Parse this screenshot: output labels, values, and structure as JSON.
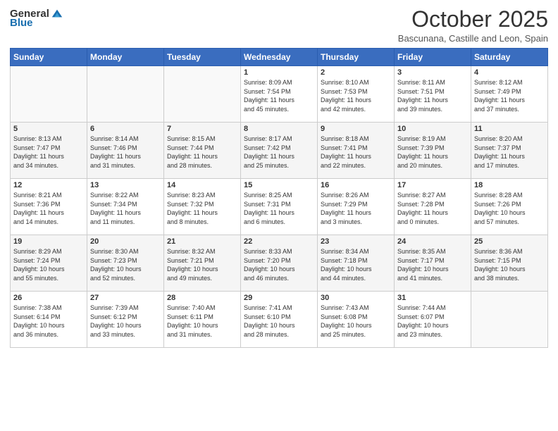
{
  "header": {
    "logo_general": "General",
    "logo_blue": "Blue",
    "month": "October 2025",
    "location": "Bascunana, Castille and Leon, Spain"
  },
  "weekdays": [
    "Sunday",
    "Monday",
    "Tuesday",
    "Wednesday",
    "Thursday",
    "Friday",
    "Saturday"
  ],
  "weeks": [
    [
      {
        "day": "",
        "info": ""
      },
      {
        "day": "",
        "info": ""
      },
      {
        "day": "",
        "info": ""
      },
      {
        "day": "1",
        "info": "Sunrise: 8:09 AM\nSunset: 7:54 PM\nDaylight: 11 hours\nand 45 minutes."
      },
      {
        "day": "2",
        "info": "Sunrise: 8:10 AM\nSunset: 7:53 PM\nDaylight: 11 hours\nand 42 minutes."
      },
      {
        "day": "3",
        "info": "Sunrise: 8:11 AM\nSunset: 7:51 PM\nDaylight: 11 hours\nand 39 minutes."
      },
      {
        "day": "4",
        "info": "Sunrise: 8:12 AM\nSunset: 7:49 PM\nDaylight: 11 hours\nand 37 minutes."
      }
    ],
    [
      {
        "day": "5",
        "info": "Sunrise: 8:13 AM\nSunset: 7:47 PM\nDaylight: 11 hours\nand 34 minutes."
      },
      {
        "day": "6",
        "info": "Sunrise: 8:14 AM\nSunset: 7:46 PM\nDaylight: 11 hours\nand 31 minutes."
      },
      {
        "day": "7",
        "info": "Sunrise: 8:15 AM\nSunset: 7:44 PM\nDaylight: 11 hours\nand 28 minutes."
      },
      {
        "day": "8",
        "info": "Sunrise: 8:17 AM\nSunset: 7:42 PM\nDaylight: 11 hours\nand 25 minutes."
      },
      {
        "day": "9",
        "info": "Sunrise: 8:18 AM\nSunset: 7:41 PM\nDaylight: 11 hours\nand 22 minutes."
      },
      {
        "day": "10",
        "info": "Sunrise: 8:19 AM\nSunset: 7:39 PM\nDaylight: 11 hours\nand 20 minutes."
      },
      {
        "day": "11",
        "info": "Sunrise: 8:20 AM\nSunset: 7:37 PM\nDaylight: 11 hours\nand 17 minutes."
      }
    ],
    [
      {
        "day": "12",
        "info": "Sunrise: 8:21 AM\nSunset: 7:36 PM\nDaylight: 11 hours\nand 14 minutes."
      },
      {
        "day": "13",
        "info": "Sunrise: 8:22 AM\nSunset: 7:34 PM\nDaylight: 11 hours\nand 11 minutes."
      },
      {
        "day": "14",
        "info": "Sunrise: 8:23 AM\nSunset: 7:32 PM\nDaylight: 11 hours\nand 8 minutes."
      },
      {
        "day": "15",
        "info": "Sunrise: 8:25 AM\nSunset: 7:31 PM\nDaylight: 11 hours\nand 6 minutes."
      },
      {
        "day": "16",
        "info": "Sunrise: 8:26 AM\nSunset: 7:29 PM\nDaylight: 11 hours\nand 3 minutes."
      },
      {
        "day": "17",
        "info": "Sunrise: 8:27 AM\nSunset: 7:28 PM\nDaylight: 11 hours\nand 0 minutes."
      },
      {
        "day": "18",
        "info": "Sunrise: 8:28 AM\nSunset: 7:26 PM\nDaylight: 10 hours\nand 57 minutes."
      }
    ],
    [
      {
        "day": "19",
        "info": "Sunrise: 8:29 AM\nSunset: 7:24 PM\nDaylight: 10 hours\nand 55 minutes."
      },
      {
        "day": "20",
        "info": "Sunrise: 8:30 AM\nSunset: 7:23 PM\nDaylight: 10 hours\nand 52 minutes."
      },
      {
        "day": "21",
        "info": "Sunrise: 8:32 AM\nSunset: 7:21 PM\nDaylight: 10 hours\nand 49 minutes."
      },
      {
        "day": "22",
        "info": "Sunrise: 8:33 AM\nSunset: 7:20 PM\nDaylight: 10 hours\nand 46 minutes."
      },
      {
        "day": "23",
        "info": "Sunrise: 8:34 AM\nSunset: 7:18 PM\nDaylight: 10 hours\nand 44 minutes."
      },
      {
        "day": "24",
        "info": "Sunrise: 8:35 AM\nSunset: 7:17 PM\nDaylight: 10 hours\nand 41 minutes."
      },
      {
        "day": "25",
        "info": "Sunrise: 8:36 AM\nSunset: 7:15 PM\nDaylight: 10 hours\nand 38 minutes."
      }
    ],
    [
      {
        "day": "26",
        "info": "Sunrise: 7:38 AM\nSunset: 6:14 PM\nDaylight: 10 hours\nand 36 minutes."
      },
      {
        "day": "27",
        "info": "Sunrise: 7:39 AM\nSunset: 6:12 PM\nDaylight: 10 hours\nand 33 minutes."
      },
      {
        "day": "28",
        "info": "Sunrise: 7:40 AM\nSunset: 6:11 PM\nDaylight: 10 hours\nand 31 minutes."
      },
      {
        "day": "29",
        "info": "Sunrise: 7:41 AM\nSunset: 6:10 PM\nDaylight: 10 hours\nand 28 minutes."
      },
      {
        "day": "30",
        "info": "Sunrise: 7:43 AM\nSunset: 6:08 PM\nDaylight: 10 hours\nand 25 minutes."
      },
      {
        "day": "31",
        "info": "Sunrise: 7:44 AM\nSunset: 6:07 PM\nDaylight: 10 hours\nand 23 minutes."
      },
      {
        "day": "",
        "info": ""
      }
    ]
  ]
}
